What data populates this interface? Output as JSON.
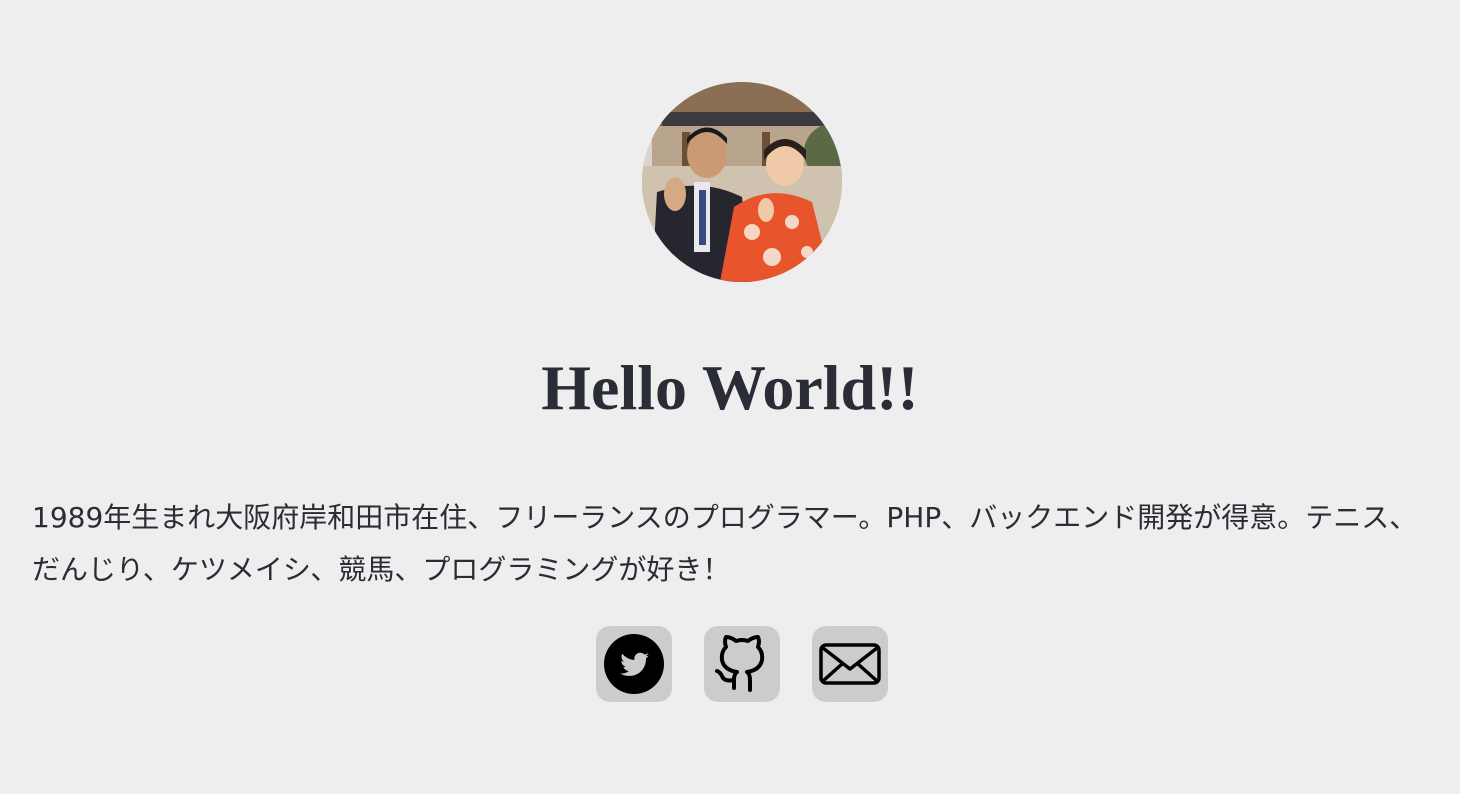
{
  "profile": {
    "avatar_alt": "profile-photo",
    "title": "Hello World!!",
    "bio": "1989年生まれ大阪府岸和田市在住、フリーランスのプログラマー。PHP、バックエンド開発が得意。テニス、だんじり、ケツメイシ、競馬、プログラミングが好き！"
  },
  "social": {
    "items": [
      {
        "icon": "twitter-icon"
      },
      {
        "icon": "github-icon"
      },
      {
        "icon": "mail-icon"
      }
    ]
  },
  "colors": {
    "background": "#eeeeee",
    "text": "#2a2c36",
    "button_bg": "#cccccc",
    "icon": "#000000"
  }
}
